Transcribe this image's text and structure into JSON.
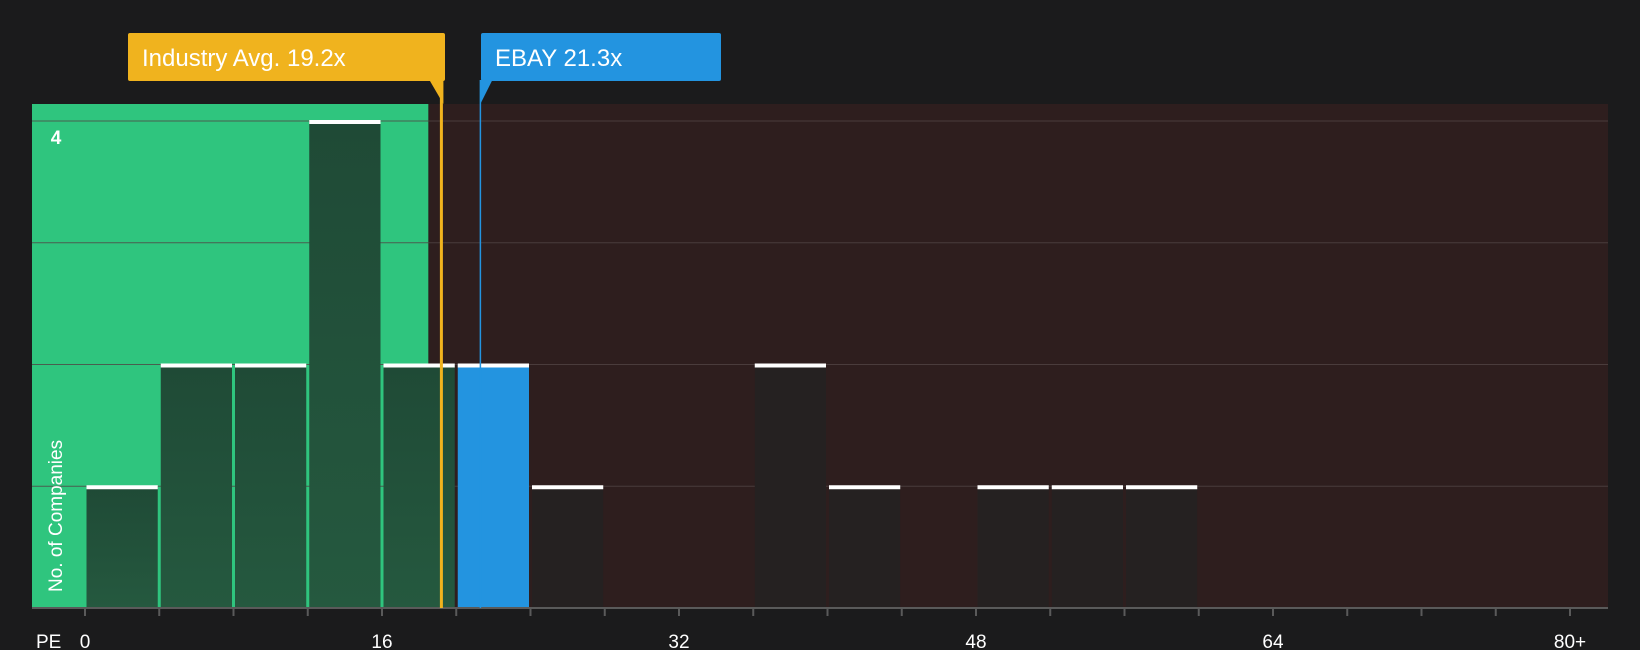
{
  "chart_data": {
    "type": "bar",
    "xlabel": "PE",
    "ylabel": "No. of Companies",
    "x_ticks": [
      "0",
      "16",
      "32",
      "48",
      "64",
      "80+"
    ],
    "x_range": [
      0,
      80
    ],
    "y_ticks": [
      "4"
    ],
    "ylim": [
      0,
      4
    ],
    "bin_width": 4,
    "bins": [
      {
        "x_start": 0,
        "x_end": 4,
        "count": 1
      },
      {
        "x_start": 4,
        "x_end": 8,
        "count": 2
      },
      {
        "x_start": 8,
        "x_end": 12,
        "count": 2
      },
      {
        "x_start": 12,
        "x_end": 16,
        "count": 4
      },
      {
        "x_start": 16,
        "x_end": 20,
        "count": 2
      },
      {
        "x_start": 20,
        "x_end": 24,
        "count": 2,
        "highlight": true
      },
      {
        "x_start": 24,
        "x_end": 28,
        "count": 1
      },
      {
        "x_start": 36,
        "x_end": 40,
        "count": 2
      },
      {
        "x_start": 40,
        "x_end": 44,
        "count": 1
      },
      {
        "x_start": 48,
        "x_end": 52,
        "count": 1
      },
      {
        "x_start": 52,
        "x_end": 56,
        "count": 1
      },
      {
        "x_start": 56,
        "x_end": 60,
        "count": 1
      }
    ],
    "fair_zone_end": 18.5,
    "industry_avg": {
      "label": "Industry Avg. 19.2x",
      "value": 19.2,
      "color": "#f0b31e"
    },
    "company": {
      "label": "EBAY 21.3x",
      "value": 21.3,
      "color": "#2394e0"
    },
    "colors": {
      "background": "#1b1b1c",
      "fair_zone": "#2fc57e",
      "over_zone": "#2e1e1e",
      "bar_in_zone": "#204d39",
      "bar_out_zone": "#252121",
      "highlight_bar": "#2394e0",
      "cap": "#ffffff",
      "grid": "#514444"
    }
  }
}
